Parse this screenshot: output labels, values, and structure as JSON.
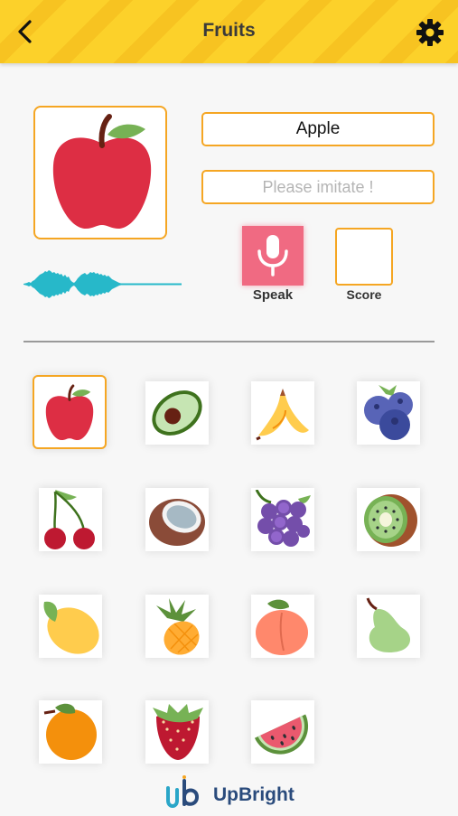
{
  "header": {
    "title": "Fruits",
    "back_icon": "chevron-left-icon",
    "settings_icon": "gear-icon",
    "bg_color": "#fcd12a"
  },
  "current": {
    "word": "Apple",
    "imitate_placeholder": "Please imitate !",
    "image_icon": "apple-icon"
  },
  "controls": {
    "speak_label": "Speak",
    "score_label": "Score",
    "speak_color": "#f06a82",
    "accent_color": "#f5a623"
  },
  "fruits": [
    {
      "name": "apple",
      "selected": true
    },
    {
      "name": "avocado"
    },
    {
      "name": "banana"
    },
    {
      "name": "blueberries"
    },
    {
      "name": "cherries"
    },
    {
      "name": "coconut"
    },
    {
      "name": "grapes"
    },
    {
      "name": "kiwi"
    },
    {
      "name": "lemon"
    },
    {
      "name": "pineapple"
    },
    {
      "name": "peach"
    },
    {
      "name": "pear"
    },
    {
      "name": "orange"
    },
    {
      "name": "strawberry"
    },
    {
      "name": "watermelon"
    }
  ],
  "footer": {
    "brand": "UpBright"
  }
}
